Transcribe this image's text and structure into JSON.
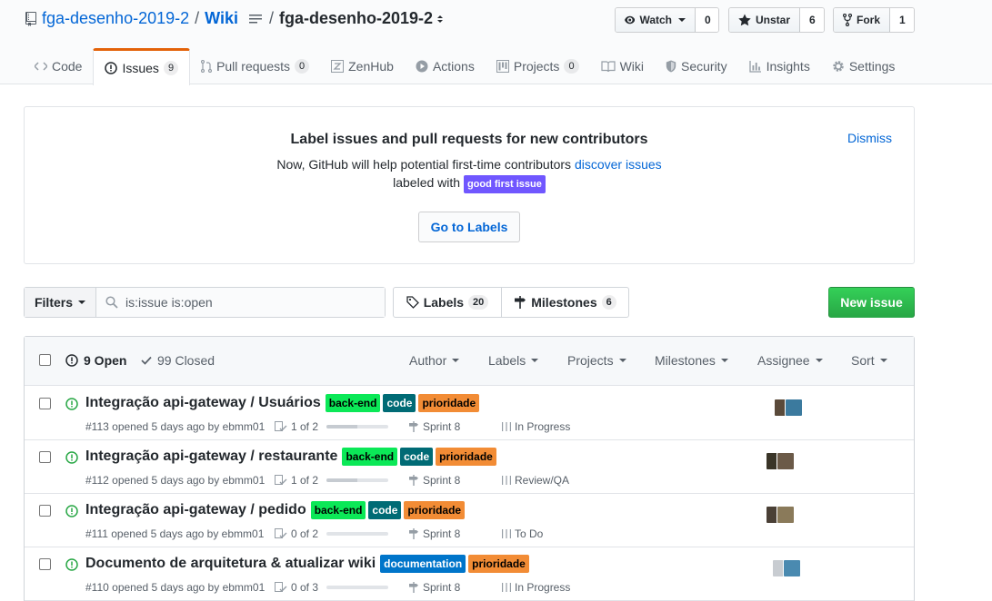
{
  "header": {
    "owner": "fga-desenho-2019-2",
    "separator": "/",
    "page": "Wiki",
    "slash": "/",
    "current_repo": "fga-desenho-2019-2",
    "watch": {
      "label": "Watch",
      "count": "0"
    },
    "star": {
      "label": "Unstar",
      "count": "6"
    },
    "fork": {
      "label": "Fork",
      "count": "1"
    }
  },
  "tabs": [
    {
      "label": "Code",
      "icon": "code-icon"
    },
    {
      "label": "Issues",
      "count": "9",
      "icon": "issue-opened-icon",
      "selected": true
    },
    {
      "label": "Pull requests",
      "count": "0",
      "icon": "git-pull-request-icon"
    },
    {
      "label": "ZenHub",
      "icon": "zenhub-icon"
    },
    {
      "label": "Actions",
      "icon": "play-icon"
    },
    {
      "label": "Projects",
      "count": "0",
      "icon": "project-icon"
    },
    {
      "label": "Wiki",
      "icon": "book-icon"
    },
    {
      "label": "Security",
      "icon": "shield-icon"
    },
    {
      "label": "Insights",
      "icon": "graph-icon"
    },
    {
      "label": "Settings",
      "icon": "gear-icon"
    }
  ],
  "banner": {
    "title": "Label issues and pull requests for new contributors",
    "line1_prefix": "Now, GitHub will help potential first-time contributors",
    "line1_link": "discover issues",
    "line2_prefix": "labeled with",
    "label": "good first issue",
    "button": "Go to Labels",
    "dismiss": "Dismiss"
  },
  "toolbar": {
    "filters": "Filters",
    "search_value": "is:issue is:open",
    "labels": "Labels",
    "labels_count": "20",
    "milestones": "Milestones",
    "milestones_count": "6",
    "new_issue": "New issue"
  },
  "list_header": {
    "open": "9 Open",
    "closed": "99 Closed",
    "filters": [
      "Author",
      "Labels",
      "Projects",
      "Milestones",
      "Assignee",
      "Sort"
    ]
  },
  "issues": [
    {
      "title": "Integração api-gateway / Usuários",
      "labels": [
        "back-end",
        "code",
        "prioridade"
      ],
      "meta": "#113 opened 5 days ago by ebmm01",
      "checklist": "1 of 2",
      "progress": 0.5,
      "milestone": "Sprint 8",
      "project": "In Progress"
    },
    {
      "title": "Integração api-gateway / restaurante",
      "labels": [
        "back-end",
        "code",
        "prioridade"
      ],
      "meta": "#112 opened 5 days ago by ebmm01",
      "checklist": "1 of 2",
      "progress": 0.5,
      "milestone": "Sprint 8",
      "project": "Review/QA"
    },
    {
      "title": "Integração api-gateway / pedido",
      "labels": [
        "back-end",
        "code",
        "prioridade"
      ],
      "meta": "#111 opened 5 days ago by ebmm01",
      "checklist": "0 of 2",
      "progress": 0,
      "milestone": "Sprint 8",
      "project": "To Do"
    },
    {
      "title": "Documento de arquitetura & atualizar wiki",
      "labels": [
        "documentation",
        "prioridade"
      ],
      "meta": "#110 opened 5 days ago by ebmm01",
      "checklist": "0 of 3",
      "progress": 0,
      "milestone": "Sprint 8",
      "project": "In Progress"
    }
  ],
  "colors": {
    "link": "#0366d6",
    "open_icon": "#28a745",
    "tab_accent": "#e36209",
    "good_first_issue": "#7057ff",
    "back-end": "#0be857",
    "code": "#006b75",
    "prioridade": "#f28c35",
    "documentation": "#0075ca",
    "new_issue": "#28a745"
  }
}
